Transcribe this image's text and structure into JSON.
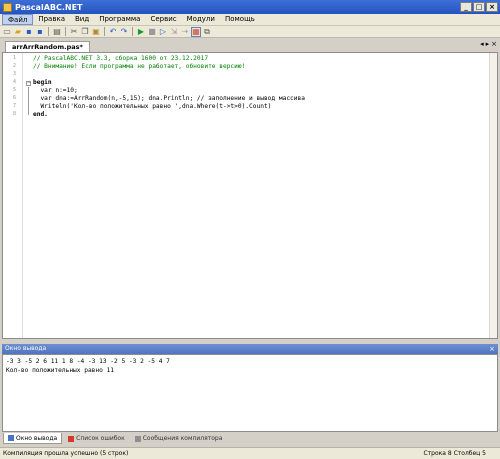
{
  "window": {
    "title": "PascalABC.NET"
  },
  "window_buttons": [
    "_",
    "□",
    "×"
  ],
  "menu": [
    "Файл",
    "Правка",
    "Вид",
    "Программа",
    "Сервис",
    "Модули",
    "Помощь"
  ],
  "toolbar": {
    "buttons": [
      "new-file-icon",
      "open-folder-icon",
      "save-icon",
      "save-all-icon",
      "print-icon",
      "cut-icon",
      "copy-icon",
      "paste-icon",
      "undo-icon",
      "redo-icon",
      "run-icon",
      "stop-icon",
      "debug-step-icon",
      "step-into-icon",
      "step-over-icon",
      "form-designer-icon",
      "output-toggle-icon"
    ],
    "glyphs": [
      "▭",
      "▰",
      "▪",
      "▪",
      "▤",
      "✂",
      "❐",
      "▣",
      "↶",
      "↷",
      "▶",
      "■",
      "▷",
      "⇲",
      "⇢",
      "▦",
      "⧉"
    ]
  },
  "editor": {
    "tab_label": "arrArrRandom.pas*",
    "tab_nav": [
      "◂",
      "▸",
      "×"
    ],
    "line_numbers": [
      "1",
      "2",
      "3",
      "4",
      "5",
      "6",
      "7",
      "8"
    ],
    "lines": [
      "// PascalABC.NET 3.3, сборка 1600 от 23.12.2017",
      "// Внимание! Если программа не работает, обновите версию!",
      "",
      "begin",
      "  var n:=10;",
      "  var dna:=ArrRandom(n,-5,15); dna.Println; // заполнение и вывод массива",
      "  Writeln('Кол-во положительных равно ',dna.Where(t->t>0).Count)",
      "end."
    ]
  },
  "output_panel": {
    "title": "Окно вывода",
    "pin": "×",
    "lines": [
      "-3 3 -5 2 6 11 1 8 -4 -3 13 -2 5 -3 2 -5 4 7",
      "Кол-во положительных равно 11"
    ]
  },
  "bottom_tabs": [
    "Окно вывода",
    "Список ошибок",
    "Сообщения компилятора"
  ],
  "status": {
    "message": "Компиляция прошла успешно (5 строк)",
    "position": "Строка  8  Столбец  5"
  }
}
